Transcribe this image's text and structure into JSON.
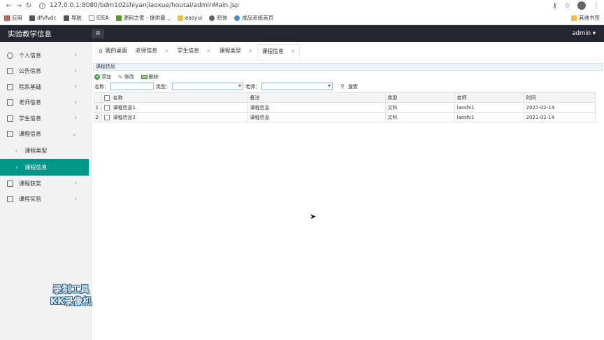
{
  "browser": {
    "url": "127.0.0.1:8080/bdm102shiyanjiaoxue/houtai/adminMain.jsp",
    "bookmarks": [
      "应用",
      "dfvfvdc",
      "导航",
      "IDEA",
      "源码之家 - 提供最...",
      "easyui",
      "短信",
      "成品系统首页"
    ],
    "other_bookmarks": "其他书签"
  },
  "header": {
    "title": "实验教学信息",
    "user": "admin"
  },
  "sidebar": {
    "items": [
      {
        "label": "个人信息"
      },
      {
        "label": "公告信息"
      },
      {
        "label": "院系基础"
      },
      {
        "label": "老师信息"
      },
      {
        "label": "学生信息"
      },
      {
        "label": "课程信息"
      }
    ],
    "subitems": [
      {
        "label": "课程类型"
      },
      {
        "label": "课程信息"
      }
    ],
    "items_after": [
      {
        "label": "课程获奖"
      },
      {
        "label": "课程实验"
      }
    ]
  },
  "tabs": [
    {
      "label": "我的桌面"
    },
    {
      "label": "老师信息"
    },
    {
      "label": "学生信息"
    },
    {
      "label": "课程类型"
    },
    {
      "label": "课程信息"
    }
  ],
  "panel": {
    "title": "课程信息",
    "toolbar": {
      "add": "添加",
      "edit": "修改",
      "delete": "删除"
    },
    "search": {
      "name_label": "名称：",
      "type_label": "类型：",
      "teacher_label": "老师：",
      "search_btn": "搜索"
    },
    "columns": [
      "名称",
      "备注",
      "类型",
      "老师",
      "时间"
    ],
    "rows": [
      {
        "num": "1",
        "name": "课程信息1",
        "note": "课程信息",
        "type": "文科",
        "teacher": "laoshi1",
        "time": "2021-02-14"
      },
      {
        "num": "2",
        "name": "课程信息2",
        "note": "课程信息",
        "type": "文科",
        "teacher": "laoshi1",
        "time": "2021-02-14"
      }
    ]
  },
  "watermark": {
    "line1": "录制工具",
    "line2": "KK录像机"
  }
}
